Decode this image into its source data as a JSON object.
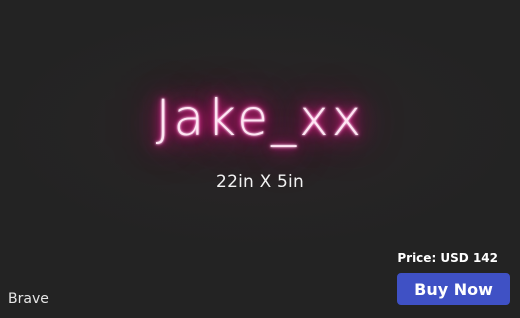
{
  "preview": {
    "neon_text": "Jake_xx",
    "size": "22in X 5in",
    "font_name": "Brave",
    "neon_color": "#ff1493",
    "background_color": "#232323"
  },
  "purchase": {
    "price": "Price: USD 142",
    "buy_label": "Buy Now",
    "button_color": "#3f51c5"
  }
}
